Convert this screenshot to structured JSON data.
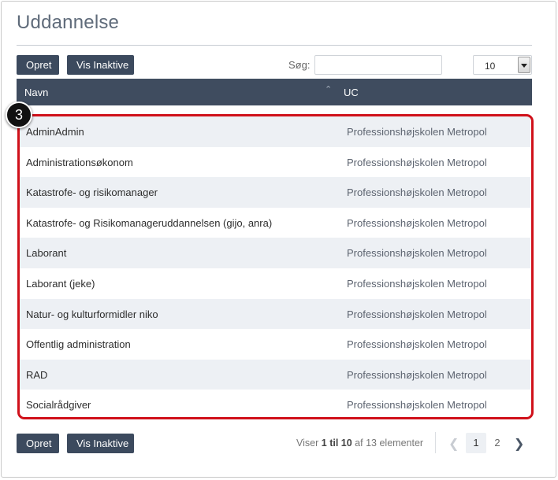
{
  "page": {
    "title": "Uddannelse"
  },
  "toolbar": {
    "create_label": "Opret",
    "inactive_label": "Vis Inaktive",
    "search_label": "Søg:",
    "search_value": "",
    "page_size": "10"
  },
  "table": {
    "columns": {
      "name": "Navn",
      "uc": "UC"
    },
    "rows": [
      {
        "name": "AdminAdmin",
        "uc": "Professionshøjskolen Metropol"
      },
      {
        "name": "Administrationsøkonom",
        "uc": "Professionshøjskolen Metropol"
      },
      {
        "name": "Katastrofe- og risikomanager",
        "uc": "Professionshøjskolen Metropol"
      },
      {
        "name": "Katastrofe- og Risikomanageruddannelsen (gijo, anra)",
        "uc": "Professionshøjskolen Metropol"
      },
      {
        "name": "Laborant",
        "uc": "Professionshøjskolen Metropol"
      },
      {
        "name": "Laborant (jeke)",
        "uc": "Professionshøjskolen Metropol"
      },
      {
        "name": "Natur- og kulturformidler niko",
        "uc": "Professionshøjskolen Metropol"
      },
      {
        "name": "Offentlig administration",
        "uc": "Professionshøjskolen Metropol"
      },
      {
        "name": "RAD",
        "uc": "Professionshøjskolen Metropol"
      },
      {
        "name": "Socialrådgiver",
        "uc": "Professionshøjskolen Metropol"
      }
    ]
  },
  "annotation": {
    "step": "3",
    "color": "#d0101a"
  },
  "footer": {
    "create_label": "Opret",
    "inactive_label": "Vis Inaktive",
    "info": {
      "prefix": "Viser",
      "from": "1",
      "to_word": "til",
      "to": "10",
      "of_word": "af",
      "total": "13",
      "suffix": "elementer"
    },
    "pages": [
      "1",
      "2"
    ],
    "prev_icon": "chevron-left-icon",
    "next_icon": "chevron-right-icon"
  }
}
